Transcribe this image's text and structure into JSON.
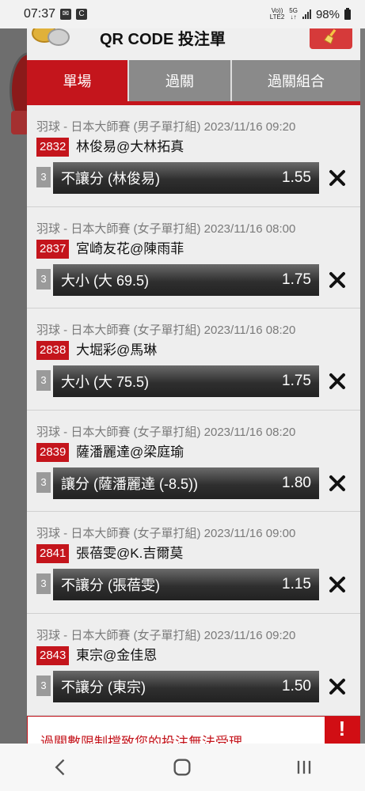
{
  "status_bar": {
    "time": "07:37",
    "net_top": "Vo))",
    "net_bottom": "LTE2",
    "sig_top": "5G",
    "sig_bottom": "↓↑",
    "battery": "98%"
  },
  "modal": {
    "title": "QR CODE 投注單",
    "clear_icon": "broom-icon"
  },
  "tabs": [
    {
      "label": "單場",
      "active": true
    },
    {
      "label": "過關",
      "active": false
    },
    {
      "label": "過關組合",
      "active": false
    }
  ],
  "bets": [
    {
      "meta": "羽球 - 日本大師賽 (男子單打組) 2023/11/16 09:20",
      "code": "2832",
      "teams": "林俊易@大林拓真",
      "num": "3",
      "selection": "不讓分 (林俊易)",
      "odds": "1.55"
    },
    {
      "meta": "羽球 - 日本大師賽 (女子單打組) 2023/11/16 08:00",
      "code": "2837",
      "teams": "宮崎友花@陳雨菲",
      "num": "3",
      "selection": "大小 (大 69.5)",
      "odds": "1.75"
    },
    {
      "meta": "羽球 - 日本大師賽 (女子單打組) 2023/11/16 08:20",
      "code": "2838",
      "teams": "大堀彩@馬琳",
      "num": "3",
      "selection": "大小 (大 75.5)",
      "odds": "1.75"
    },
    {
      "meta": "羽球 - 日本大師賽 (女子單打組) 2023/11/16 08:20",
      "code": "2839",
      "teams": "薩潘麗達@梁庭瑜",
      "num": "3",
      "selection": "讓分 (薩潘麗達 (-8.5))",
      "odds": "1.80"
    },
    {
      "meta": "羽球 - 日本大師賽 (女子單打組) 2023/11/16 09:00",
      "code": "2841",
      "teams": "張蓓雯@K.吉爾莫",
      "num": "3",
      "selection": "不讓分 (張蓓雯)",
      "odds": "1.15"
    },
    {
      "meta": "羽球 - 日本大師賽 (女子單打組) 2023/11/16 09:20",
      "code": "2843",
      "teams": "東宗@金佳恩",
      "num": "3",
      "selection": "不讓分 (東宗)",
      "odds": "1.50"
    }
  ],
  "warning": {
    "text": "過關數限制擋致您的投注無法受理",
    "icon": "!"
  },
  "nav": {
    "back_icon": "back-icon",
    "home_icon": "home-icon",
    "recents_icon": "recents-icon"
  },
  "colors": {
    "accent_red": "#c4151c",
    "tab_inactive": "#8a8a8a"
  }
}
